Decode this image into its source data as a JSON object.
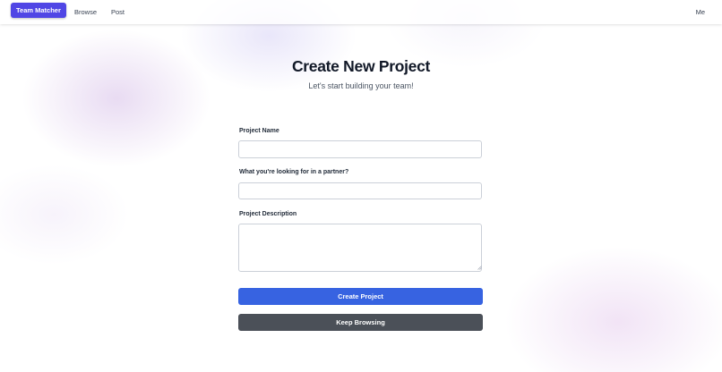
{
  "nav": {
    "brand": "Team Matcher",
    "links": [
      "Browse",
      "Post"
    ],
    "user": "Me"
  },
  "page": {
    "title": "Create New Project",
    "subtitle": "Let's start building your team!"
  },
  "form": {
    "project_name_label": "Project Name",
    "project_name_value": "",
    "partner_label": "What you're looking for in a partner?",
    "partner_value": "",
    "description_label": "Project Description",
    "description_value": ""
  },
  "buttons": {
    "create": "Create Project",
    "keep_browsing": "Keep Browsing"
  },
  "colors": {
    "brand": "#5046e5",
    "primary": "#3763e1",
    "secondary": "#4b5058"
  }
}
